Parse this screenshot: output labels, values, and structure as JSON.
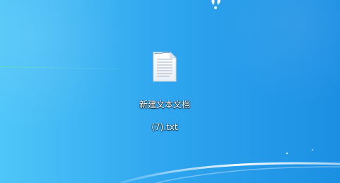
{
  "desktop": {
    "icon": {
      "type": "text-file",
      "name_line1": "新建文本文档",
      "name_line2": "(7).txt"
    },
    "background": {
      "primary_color": "#2fa6ef",
      "accent_color": "#4fc6f8",
      "wave_color": "#ffffff"
    }
  }
}
